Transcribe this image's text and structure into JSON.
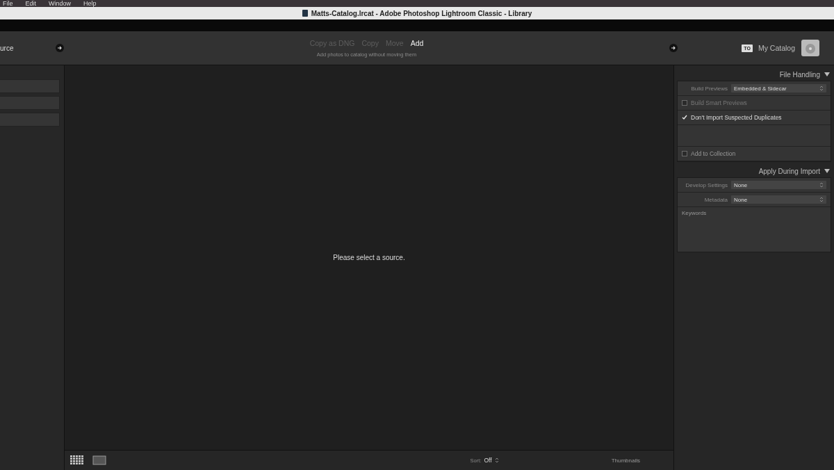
{
  "menu_bar": {
    "items": [
      "File",
      "Edit",
      "Window",
      "Help"
    ]
  },
  "window": {
    "title": "Matts-Catalog.lrcat - Adobe Photoshop Lightroom Classic - Library"
  },
  "header": {
    "source_label": "urce",
    "modes": [
      {
        "label": "Copy as DNG",
        "selected": false
      },
      {
        "label": "Copy",
        "selected": false
      },
      {
        "label": "Move",
        "selected": false
      },
      {
        "label": "Add",
        "selected": true
      }
    ],
    "mode_hint": "Add photos to catalog without moving them",
    "destination_badge": "TO",
    "destination": "My Catalog"
  },
  "center": {
    "message": "Please select a source."
  },
  "file_handling": {
    "title": "File Handling",
    "expanded": true,
    "build_previews_label": "Build Previews",
    "build_previews_value": "Embedded & Sidecar",
    "options": [
      {
        "label": "Build Smart Previews",
        "checked": false
      },
      {
        "label": "Don't Import Suspected Duplicates",
        "checked": true
      }
    ],
    "collection": {
      "label": "Add to Collection",
      "checked": false
    }
  },
  "apply_during_import": {
    "title": "Apply During Import",
    "expanded": true,
    "fields": [
      {
        "label": "Develop Settings",
        "value": "None"
      },
      {
        "label": "Metadata",
        "value": "None"
      }
    ],
    "keywords_label": "Keywords"
  },
  "toolbar": {
    "sort_label": "Sort:",
    "sort_value": "Off",
    "thumbnails_label": "Thumbnails"
  }
}
